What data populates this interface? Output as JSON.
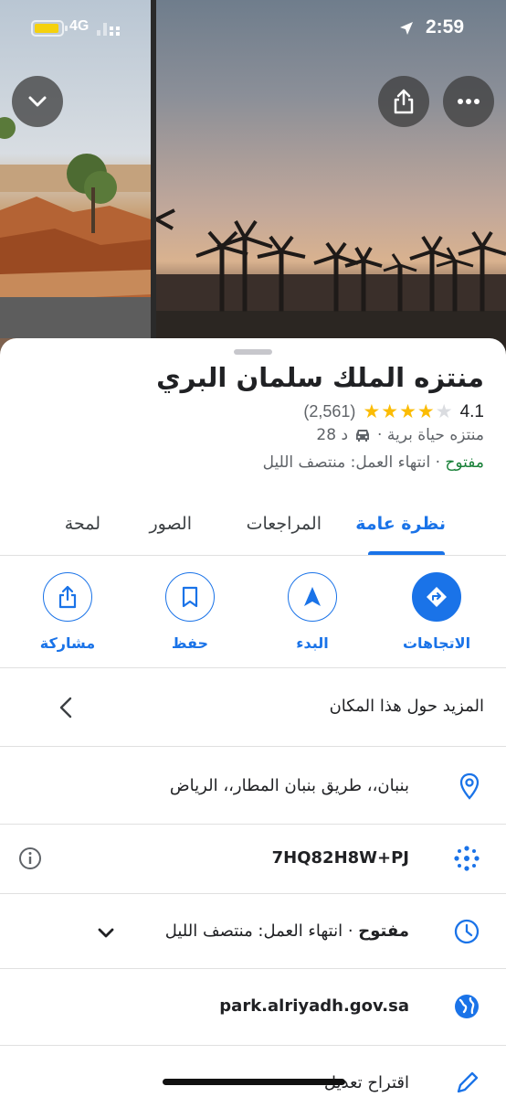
{
  "status_bar": {
    "network": "4G",
    "time": "2:59"
  },
  "place": {
    "name": "منتزه الملك سلمان البري",
    "rating": "4.1",
    "stars_filled": 4,
    "stars_total": 5,
    "reviews_count": "(2,561)",
    "category": "منتزه حياة برية ·",
    "drive_time": "28 د",
    "open_status": "مفتوح",
    "hours_text": " · انتهاء العمل: منتصف الليل"
  },
  "tabs": [
    {
      "label": "نظرة عامة",
      "active": true
    },
    {
      "label": "المراجعات"
    },
    {
      "label": "الصور"
    },
    {
      "label": "لمحة"
    }
  ],
  "actions": [
    {
      "label": "الاتجاهات",
      "icon": "directions-icon"
    },
    {
      "label": "البدء",
      "icon": "navigation-icon"
    },
    {
      "label": "حفظ",
      "icon": "bookmark-icon"
    },
    {
      "label": "مشاركة",
      "icon": "share-icon"
    }
  ],
  "details": {
    "about": "المزيد حول هذا المكان",
    "address": "بنبان،، طريق بنبان المطار،، الرياض",
    "plus_code": "7HQ82H8W+PJ",
    "hours_open": "مفتوح",
    "hours_rest": " · انتهاء العمل: منتصف الليل",
    "website": "park.alriyadh.gov.sa",
    "suggest_edit": "اقتراح تعديل"
  },
  "colors": {
    "accent": "#1a73e8",
    "open": "#188038",
    "star": "#fbbc04"
  }
}
